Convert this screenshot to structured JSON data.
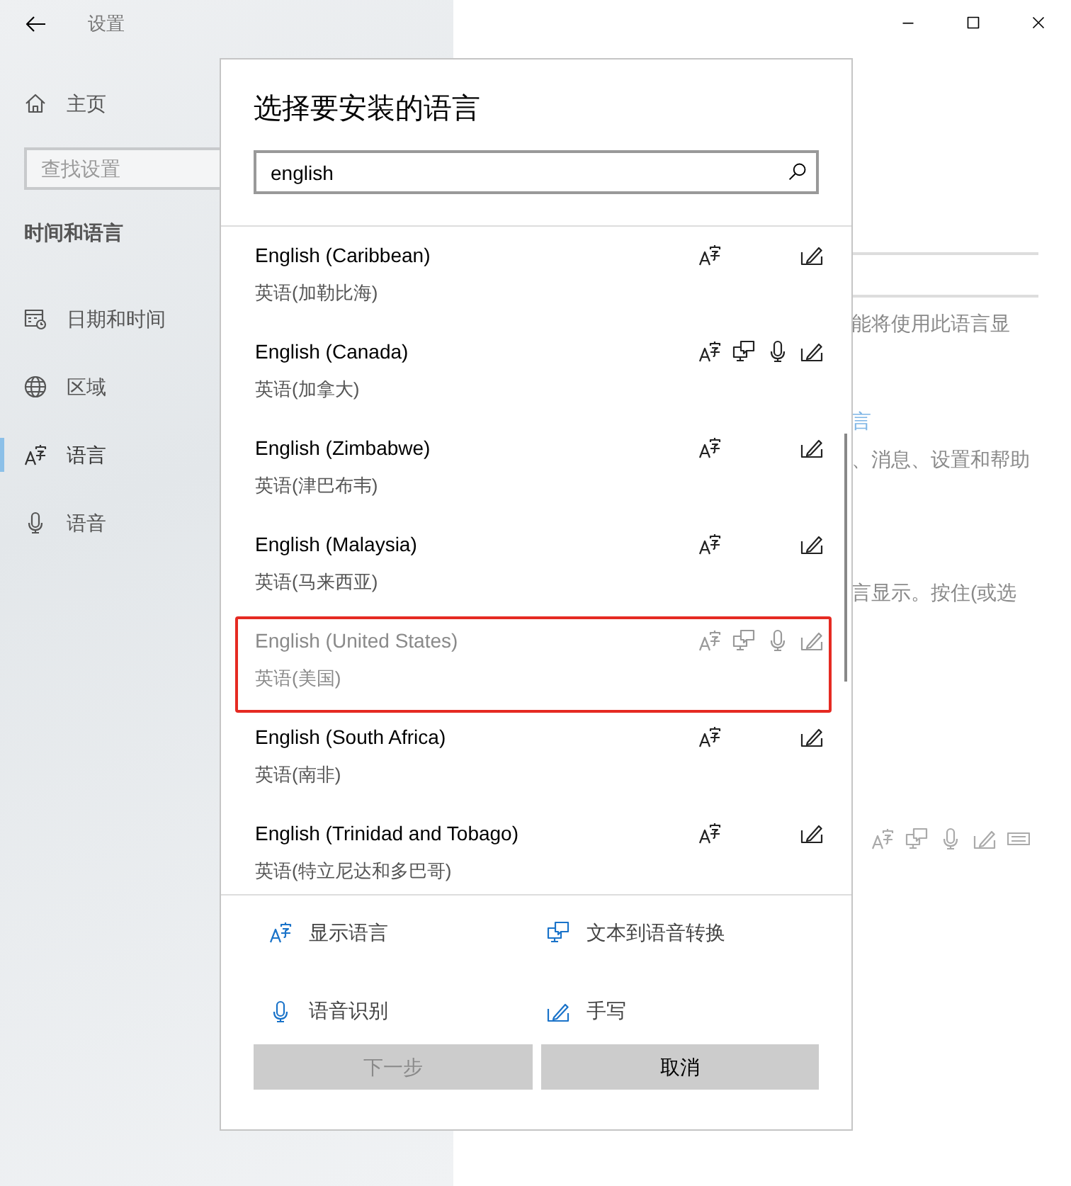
{
  "window": {
    "title": "设置"
  },
  "sidebar": {
    "home": "主页",
    "search": {
      "placeholder": "查找设置"
    },
    "section": "时间和语言",
    "items": [
      {
        "label": "日期和时间",
        "selected": false
      },
      {
        "label": "区域",
        "selected": false
      },
      {
        "label": "语言",
        "selected": true
      },
      {
        "label": "语音",
        "selected": false
      }
    ]
  },
  "background_page": {
    "texts": [
      {
        "kind": "text",
        "text": "能将使用此语言显"
      },
      {
        "kind": "link",
        "text": "言"
      },
      {
        "kind": "text",
        "text": "、消息、设置和帮助"
      },
      {
        "kind": "text",
        "text": "言显示。按住(或选"
      }
    ]
  },
  "dialog": {
    "title": "选择要安装的语言",
    "search": {
      "value": "english"
    },
    "languages": [
      {
        "name": "English (Caribbean)",
        "native": "英语(加勒比海)",
        "features": {
          "display": true,
          "tts": false,
          "speech": false,
          "handwriting": true
        },
        "disabled": false,
        "highlighted": false
      },
      {
        "name": "English (Canada)",
        "native": "英语(加拿大)",
        "features": {
          "display": true,
          "tts": true,
          "speech": true,
          "handwriting": true
        },
        "disabled": false,
        "highlighted": false
      },
      {
        "name": "English (Zimbabwe)",
        "native": "英语(津巴布韦)",
        "features": {
          "display": true,
          "tts": false,
          "speech": false,
          "handwriting": true
        },
        "disabled": false,
        "highlighted": false
      },
      {
        "name": "English (Malaysia)",
        "native": "英语(马来西亚)",
        "features": {
          "display": true,
          "tts": false,
          "speech": false,
          "handwriting": true
        },
        "disabled": false,
        "highlighted": false
      },
      {
        "name": "English (United States)",
        "native": "英语(美国)",
        "features": {
          "display": true,
          "tts": true,
          "speech": true,
          "handwriting": true
        },
        "disabled": true,
        "highlighted": true
      },
      {
        "name": "English (South Africa)",
        "native": "英语(南非)",
        "features": {
          "display": true,
          "tts": false,
          "speech": false,
          "handwriting": true
        },
        "disabled": false,
        "highlighted": false
      },
      {
        "name": "English (Trinidad and Tobago)",
        "native": "英语(特立尼达和多巴哥)",
        "features": {
          "display": true,
          "tts": false,
          "speech": false,
          "handwriting": true
        },
        "disabled": false,
        "highlighted": false
      }
    ],
    "legend": [
      {
        "label": "显示语言"
      },
      {
        "label": "文本到语音转换"
      },
      {
        "label": "语音识别"
      },
      {
        "label": "手写"
      }
    ],
    "buttons": [
      {
        "label": "下一步",
        "disabled": true
      },
      {
        "label": "取消",
        "disabled": false
      }
    ]
  }
}
